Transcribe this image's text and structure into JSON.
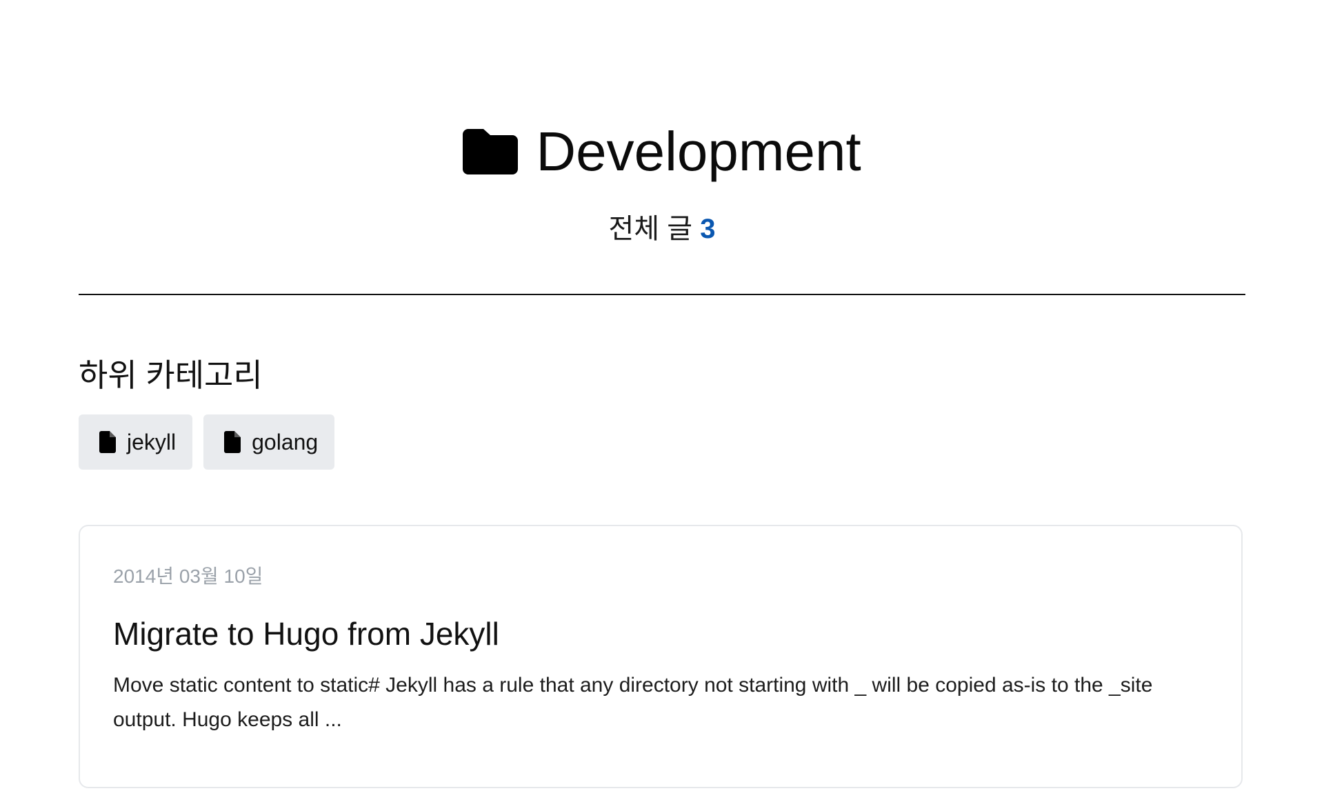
{
  "category": {
    "title": "Development",
    "icon": "folder-icon",
    "count_label": "전체 글",
    "count_value": "3",
    "accent_color": "#0a57b0"
  },
  "subcategories": {
    "heading": "하위 카테고리",
    "items": [
      {
        "label": "jekyll",
        "icon": "file-icon"
      },
      {
        "label": "golang",
        "icon": "file-icon"
      }
    ]
  },
  "posts": [
    {
      "date": "2014년 03월 10일",
      "title": "Migrate to Hugo from Jekyll",
      "excerpt": "Move static content to static# Jekyll has a rule that any directory not starting with _ will be copied as-is to the _site output. Hugo keeps all ..."
    }
  ]
}
